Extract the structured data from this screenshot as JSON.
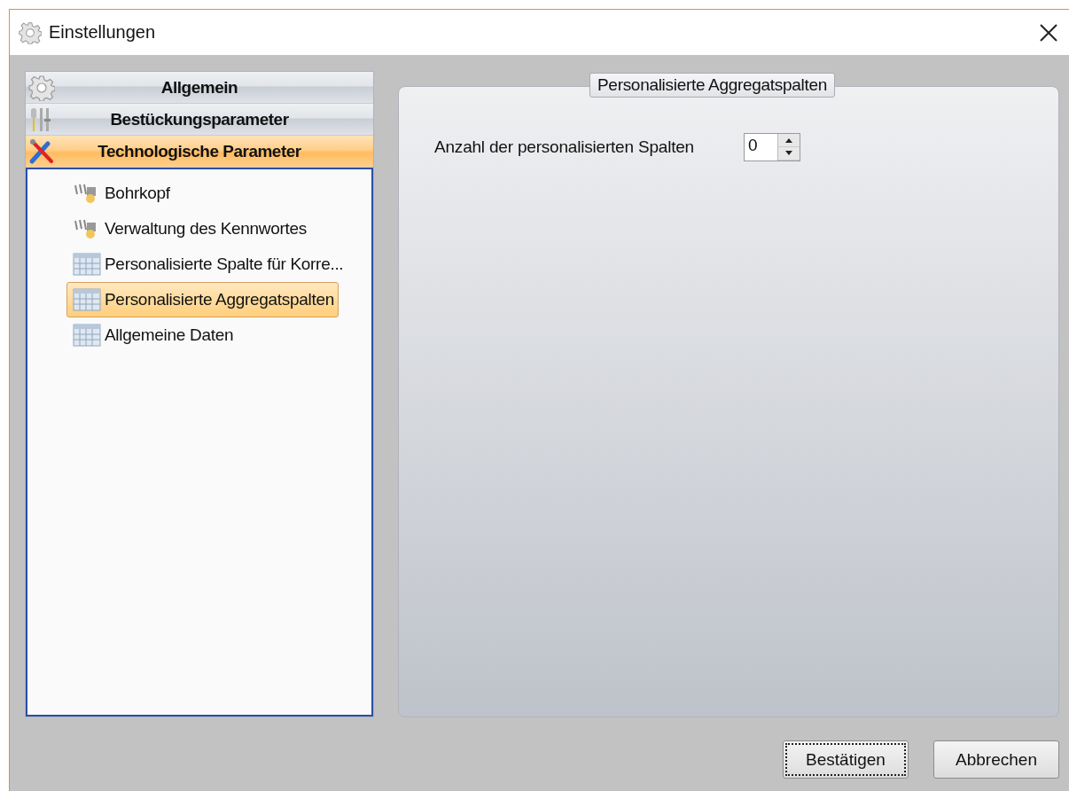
{
  "window": {
    "title": "Einstellungen"
  },
  "sections": [
    {
      "label": "Allgemein",
      "kind": "gear",
      "selected": false
    },
    {
      "label": "Bestückungsparameter",
      "kind": "tools",
      "selected": false
    },
    {
      "label": "Technologische Parameter",
      "kind": "wrench",
      "selected": true
    }
  ],
  "tree": [
    {
      "label": "Bohrkopf",
      "kind": "device",
      "selected": false
    },
    {
      "label": "Verwaltung des Kennwortes",
      "kind": "device",
      "selected": false
    },
    {
      "label": "Personalisierte Spalte für Korre...",
      "kind": "grid",
      "selected": false
    },
    {
      "label": "Personalisierte Aggregatspalten",
      "kind": "grid",
      "selected": true
    },
    {
      "label": "Allgemeine Daten",
      "kind": "grid",
      "selected": false
    }
  ],
  "group": {
    "title": "Personalisierte Aggregatspalten",
    "fields": [
      {
        "label": "Anzahl der personalisierten Spalten",
        "value": "0"
      }
    ]
  },
  "buttons": [
    {
      "label": "Bestätigen",
      "focused": true
    },
    {
      "label": "Abbrechen",
      "focused": false
    }
  ]
}
